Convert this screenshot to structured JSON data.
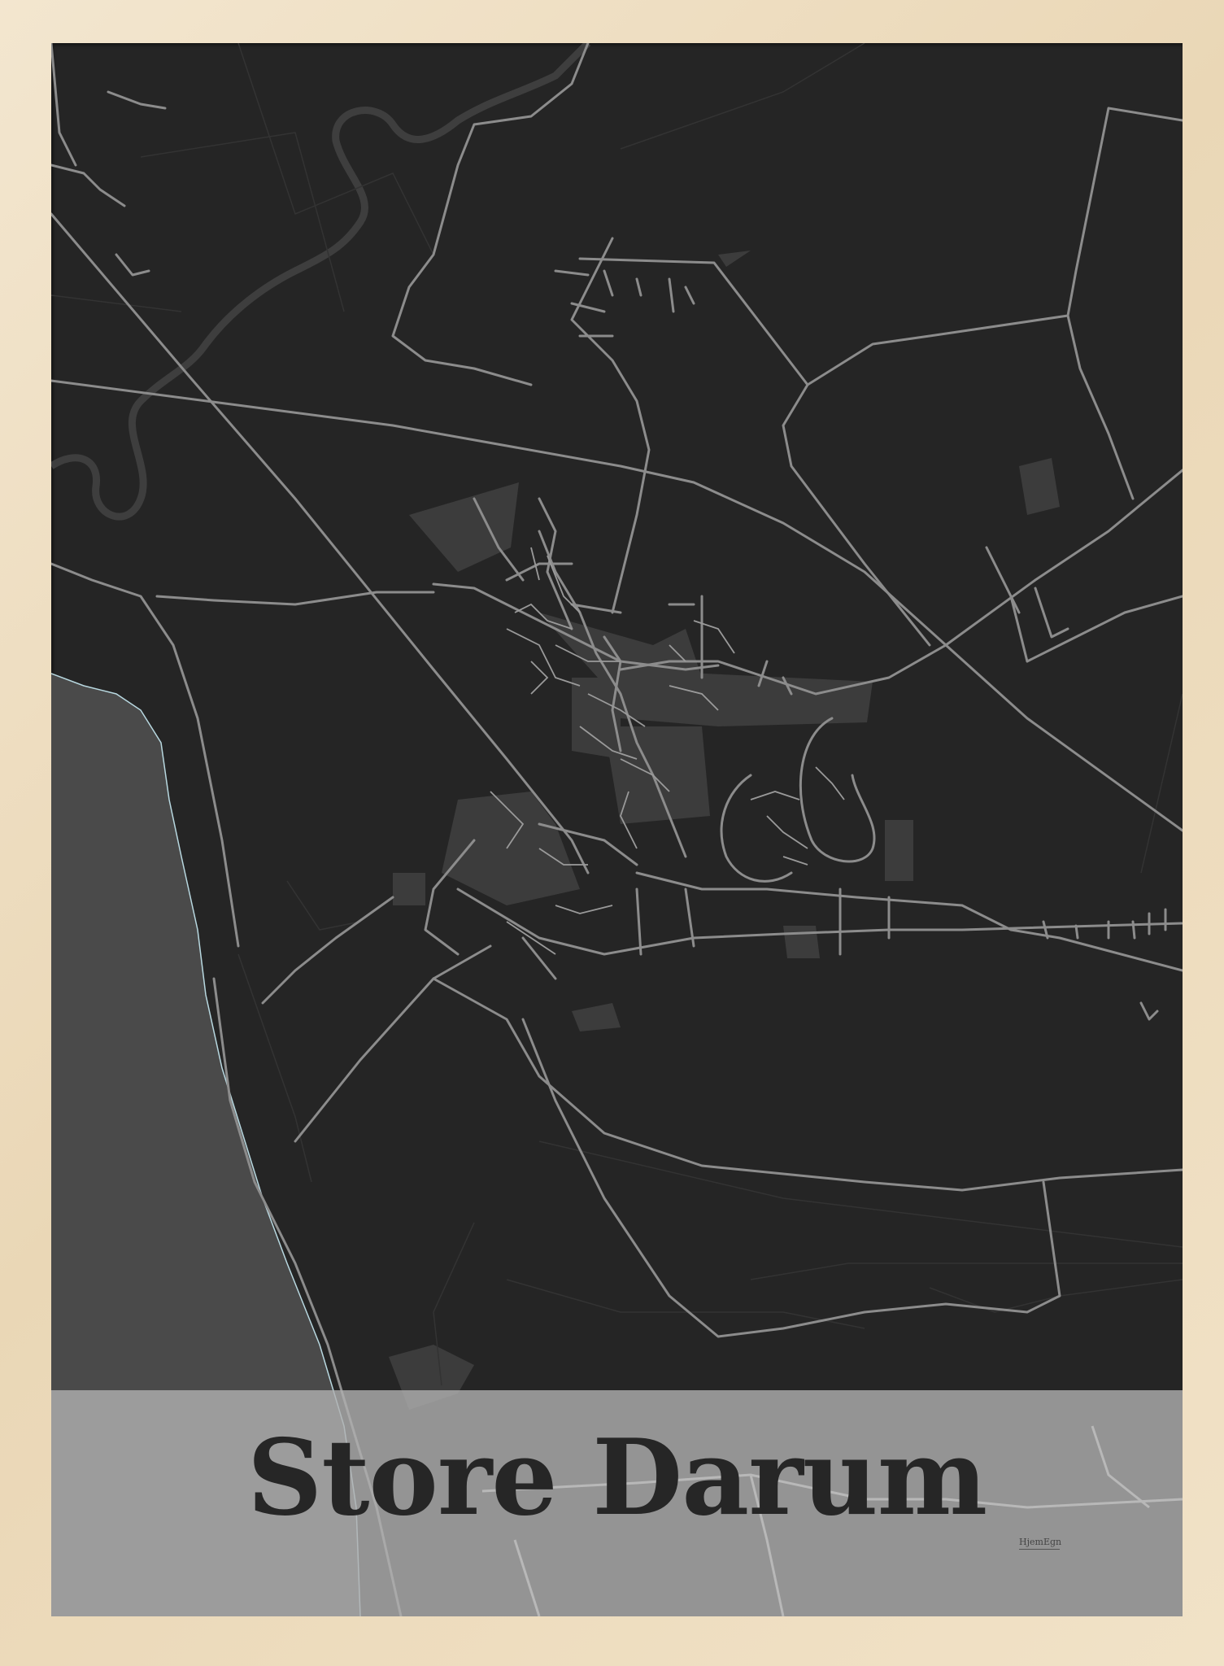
{
  "poster": {
    "title": "Store Darum",
    "brand": "HjemEgn"
  },
  "colors": {
    "frame": "#efe0c6",
    "land": "#252525",
    "water": "#4a4a4a",
    "roads": "#8c8c8c",
    "built_area": "#3c3c3c",
    "title_band": "#b0b0b0",
    "title_text": "#262626"
  }
}
